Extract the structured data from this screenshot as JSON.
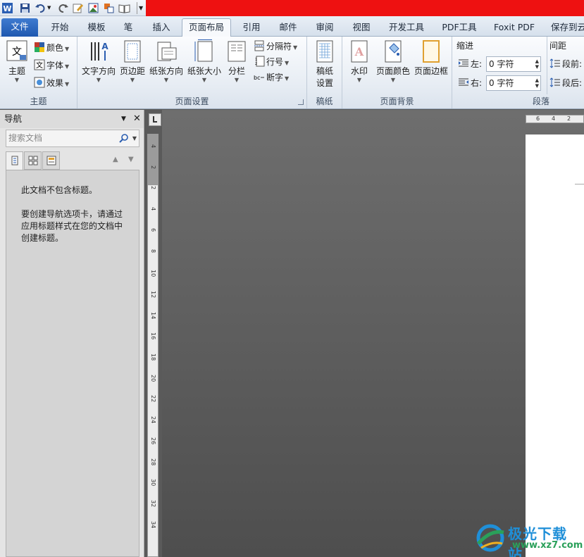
{
  "quick_access": {
    "icons": [
      "word-app-icon",
      "save-icon",
      "undo-icon",
      "redo-icon",
      "edit-icon",
      "image-icon",
      "layout-icon",
      "book-icon",
      "customize-icon"
    ]
  },
  "tabs": [
    {
      "label": "文件"
    },
    {
      "label": "开始"
    },
    {
      "label": "模板"
    },
    {
      "label": "笔"
    },
    {
      "label": "插入"
    },
    {
      "label": "页面布局"
    },
    {
      "label": "引用"
    },
    {
      "label": "邮件"
    },
    {
      "label": "审阅"
    },
    {
      "label": "视图"
    },
    {
      "label": "开发工具"
    },
    {
      "label": "PDF工具"
    },
    {
      "label": "Foxit PDF"
    },
    {
      "label": "保存到云"
    }
  ],
  "ribbon": {
    "theme": {
      "title": "主题",
      "theme_btn": "主题",
      "colors": "颜色",
      "fonts": "字体",
      "effects": "效果"
    },
    "page_setup": {
      "title": "页面设置",
      "text_direction": "文字方向",
      "margins": "页边距",
      "orientation": "纸张方向",
      "size": "纸张大小",
      "columns": "分栏",
      "breaks": "分隔符",
      "line_numbers": "行号",
      "hyphenation": "断字"
    },
    "manuscript": {
      "title": "稿纸",
      "btn_line1": "稿纸",
      "btn_line2": "设置"
    },
    "page_background": {
      "title": "页面背景",
      "watermark": "水印",
      "page_color": "页面颜色",
      "page_borders": "页面边框"
    },
    "paragraph": {
      "title": "段落",
      "indent": "缩进",
      "left_label": "左:",
      "left_value": "0 字符",
      "right_label": "右:",
      "right_value": "0 字符",
      "spacing": "间距",
      "before_label": "段前:",
      "after_label": "段后:"
    }
  },
  "nav_pane": {
    "title": "导航",
    "search_placeholder": "搜索文档",
    "message_1": "此文档不包含标题。",
    "message_2": "要创建导航选项卡，请通过应用标题样式在您的文档中创建标题。"
  },
  "vruler_ticks": [
    "4",
    "2",
    "2",
    "4",
    "6",
    "8",
    "10",
    "12",
    "14",
    "16",
    "18",
    "20",
    "22",
    "24",
    "26",
    "28",
    "30",
    "32",
    "34"
  ],
  "hruler_ticks": [
    "6",
    "4",
    "2"
  ],
  "watermark": {
    "line1": "极光下载站",
    "line2": "www.xz7.com"
  }
}
